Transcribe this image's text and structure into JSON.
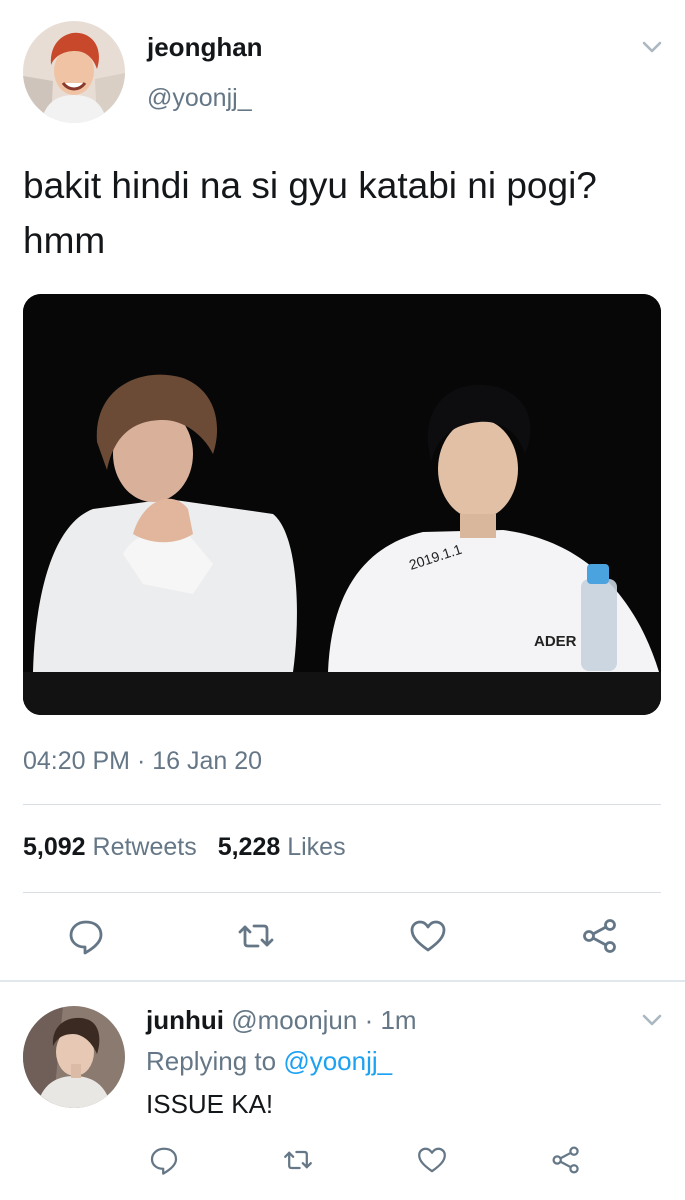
{
  "colors": {
    "text": "#14171a",
    "secondary": "#657786",
    "link": "#1da1f2",
    "divider": "#e1e8ed"
  },
  "tweet": {
    "author": {
      "display_name": "jeonghan",
      "handle": "@yoonjj_"
    },
    "text": "bakit hindi na si gyu katabi ni pogi? hmm",
    "photo": {
      "shirt_text_left": "ADER",
      "signature": "2019.1.1"
    },
    "timestamp": "04:20 PM · 16 Jan 20",
    "stats": {
      "retweets_count": "5,092",
      "retweets_label": "Retweets",
      "likes_count": "5,228",
      "likes_label": "Likes"
    },
    "actions": [
      "reply-icon",
      "retweet-icon",
      "like-icon",
      "share-icon"
    ]
  },
  "reply": {
    "display_name": "junhui",
    "handle": "@moonjun",
    "separator": " · ",
    "time": "1m",
    "replying_prefix": "Replying to ",
    "replying_to": "@yoonjj_",
    "text": "ISSUE KA!",
    "actions": [
      "reply-icon",
      "retweet-icon",
      "like-icon",
      "share-icon"
    ]
  }
}
